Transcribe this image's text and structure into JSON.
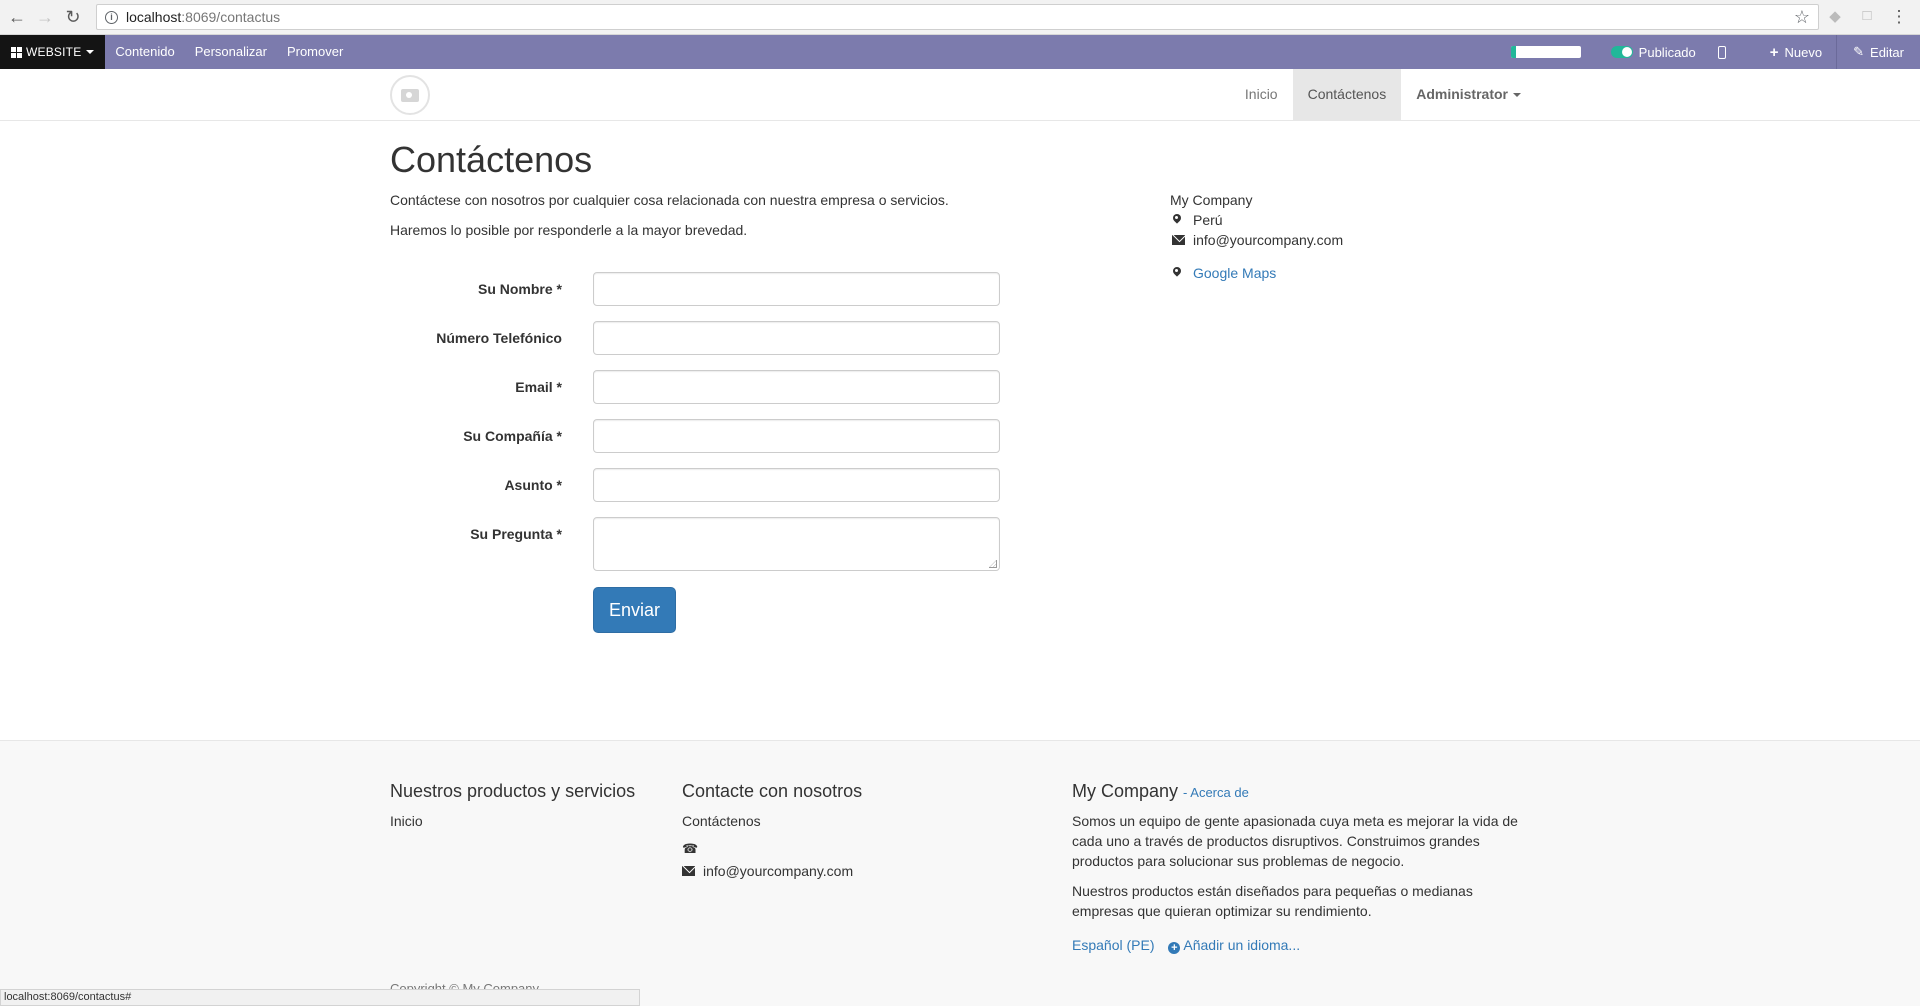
{
  "browser": {
    "url_host": "localhost",
    "url_path": ":8069/contactus",
    "status_url": "localhost:8069/contactus#"
  },
  "odoo_bar": {
    "website_label": "WEBSITE",
    "menu": [
      "Contenido",
      "Personalizar",
      "Promover"
    ],
    "published_label": "Publicado",
    "new_label": "Nuevo",
    "edit_label": "Editar",
    "progress_fraction": 0.08,
    "accent_color": "#7c7bad",
    "published_color": "#21b799"
  },
  "header": {
    "menu": [
      "Inicio",
      "Contáctenos",
      "Administrator"
    ]
  },
  "main": {
    "title": "Contáctenos",
    "intro1": "Contáctese con nosotros por cualquier cosa relacionada con nuestra empresa o servicios.",
    "intro2": "Haremos lo posible por responderle a la mayor brevedad.",
    "fields": [
      {
        "label": "Su Nombre *"
      },
      {
        "label": "Número Telefónico"
      },
      {
        "label": "Email *"
      },
      {
        "label": "Su Compañía *"
      },
      {
        "label": "Asunto *"
      },
      {
        "label": "Su Pregunta *"
      }
    ],
    "submit_label": "Enviar"
  },
  "aside": {
    "company": "My Company",
    "country": "Perú",
    "email": "info@yourcompany.com",
    "maps_label": "Google Maps"
  },
  "footer": {
    "col1_title": "Nuestros productos y servicios",
    "col1_link": "Inicio",
    "col2_title": "Contacte con nosotros",
    "col2_link": "Contáctenos",
    "col2_email": "info@yourcompany.com",
    "col3_title": "My Company",
    "col3_about": "- Acerca de",
    "col3_p1_l1": "Somos un equipo de gente apasionada cuya meta es mejorar la vida de",
    "col3_p1_l2": "cada uno a través de productos disruptivos. Construimos grandes",
    "col3_p1_l3": "productos para solucionar sus problemas de negocio.",
    "col3_p2_l1": "Nuestros productos están diseñados para pequeñas o medianas",
    "col3_p2_l2": "empresas que quieran optimizar su rendimiento.",
    "lang_current": "Español (PE)",
    "lang_add": "Añadir un idioma...",
    "copyright": "Copyright © My Company"
  },
  "icons": [
    "back-arrow-icon",
    "forward-arrow-icon",
    "reload-icon",
    "info-icon",
    "star-icon",
    "apps-grid-icon",
    "mobile-icon",
    "plus-icon",
    "pencil-icon",
    "camera-icon",
    "map-marker-icon",
    "envelope-icon",
    "phone-icon",
    "plus-circle-icon"
  ]
}
